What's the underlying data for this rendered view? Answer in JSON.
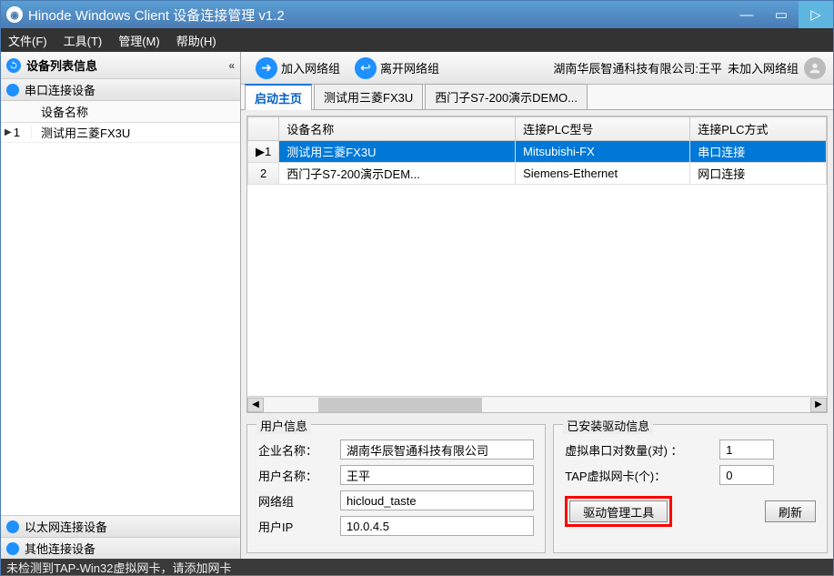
{
  "window": {
    "title": "Hinode Windows Client 设备连接管理 v1.2"
  },
  "menu": {
    "file": "文件(F)",
    "tool": "工具(T)",
    "manage": "管理(M)",
    "help": "帮助(H)"
  },
  "sidebar": {
    "header": "设备列表信息",
    "sub": "串口连接设备",
    "col": "设备名称",
    "rows": [
      {
        "n": "1",
        "name": "测试用三菱FX3U"
      }
    ],
    "bottom": [
      {
        "label": "以太网连接设备"
      },
      {
        "label": "其他连接设备"
      }
    ]
  },
  "toolbar": {
    "join": "加入网络组",
    "leave": "离开网络组",
    "org_user": "湖南华辰智通科技有限公司:王平",
    "status": "未加入网络组"
  },
  "tabs": {
    "main": "启动主页",
    "t1": "测试用三菱FX3U",
    "t2": "西门子S7-200演示DEMO..."
  },
  "grid": {
    "headers": {
      "name": "设备名称",
      "plc": "连接PLC型号",
      "method": "连接PLC方式"
    },
    "rows": [
      {
        "n": "1",
        "name": "测试用三菱FX3U",
        "plc": "Mitsubishi-FX",
        "method": "串口连接",
        "sel": true
      },
      {
        "n": "2",
        "name": "西门子S7-200演示DEM...",
        "plc": "Siemens-Ethernet",
        "method": "网口连接",
        "sel": false
      }
    ]
  },
  "user_panel": {
    "legend": "用户信息",
    "company_lbl": "企业名称：",
    "company": "湖南华辰智通科技有限公司",
    "user_lbl": "用户名称：",
    "user": "王平",
    "group_lbl": "网络组",
    "group": "hicloud_taste",
    "ip_lbl": "用户IP",
    "ip": "10.0.4.5"
  },
  "driver_panel": {
    "legend": "已安装驱动信息",
    "vcom_lbl": "虚拟串口对数量(对)  ：",
    "vcom": "1",
    "tap_lbl": "TAP虚拟网卡(个)：",
    "tap": "0",
    "manage_btn": "驱动管理工具",
    "refresh_btn": "刷新"
  },
  "status": "未检测到TAP-Win32虚拟网卡，请添加网卡"
}
